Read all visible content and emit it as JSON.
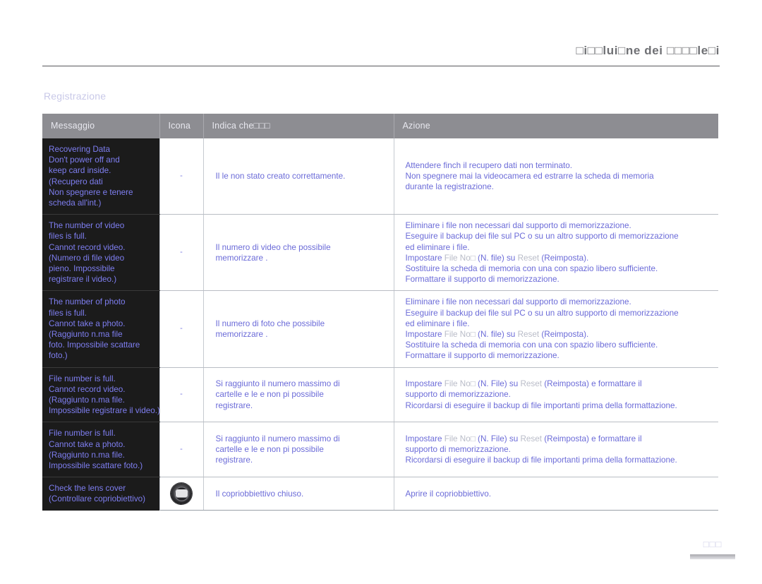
{
  "header": {
    "title": "□i□□lui□ne dei □□□□le□i"
  },
  "section": {
    "title": "Registrazione"
  },
  "table": {
    "columns": [
      "Messaggio",
      "Icona",
      "Indica che□□□",
      "Azione"
    ],
    "rows": [
      {
        "message": [
          "Recovering Data",
          "Don't power off and",
          "keep card inside.",
          "(Recupero dati",
          "Non spegnere e tenere",
          "scheda all'int.)"
        ],
        "icon": "dash-icon",
        "icon_label": "-",
        "description": [
          "Il  le non  stato creato correttamente."
        ],
        "action": [
          "Attendere finch il recupero dati non  terminato.",
          "Non spegnere mai la videocamera ed estrarre la scheda di memoria",
          "durante la registrazione."
        ]
      },
      {
        "message": [
          "The number of video",
          "files is full.",
          "Cannot record video.",
          "(Numero di file video",
          "pieno. Impossibile",
          "registrare il video.)"
        ],
        "icon": "dash-icon",
        "icon_label": "-",
        "description": [
          "Il numero di video che  possibile",
          "memorizzare       ."
        ],
        "action": [
          "Eliminare i file non necessari dal supporto di memorizzazione.",
          "Eseguire il backup dei file sul PC o su un altro supporto di memorizzazione",
          "ed eliminare i file.",
          "Sostituire la scheda di memoria con una con spazio libero sufficiente.",
          "Formattare il supporto di memorizzazione."
        ],
        "action_menu_line": {
          "prefix": "Impostare ",
          "term1": "File No□",
          "mid": " (N. file) su ",
          "term2": "Reset",
          "suffix": " (Reimposta).",
          "index": 3
        }
      },
      {
        "message": [
          "The number of photo",
          "files is full.",
          "Cannot take a photo.",
          "(Raggiunto n.ma  file",
          "foto. Impossibile scattare",
          "foto.)"
        ],
        "icon": "dash-icon",
        "icon_label": "-",
        "description": [
          "Il numero di foto che  possibile",
          "memorizzare       ."
        ],
        "action": [
          "Eliminare i file non necessari dal supporto di memorizzazione.",
          "Eseguire il backup dei file sul PC o su un altro supporto di memorizzazione",
          "ed eliminare i file.",
          "Sostituire la scheda di memoria con una con spazio libero sufficiente.",
          "Formattare il supporto di memorizzazione."
        ],
        "action_menu_line": {
          "prefix": "Impostare ",
          "term1": "File No□",
          "mid": " (N. file) su ",
          "term2": "Reset",
          "suffix": " (Reimposta).",
          "index": 3
        }
      },
      {
        "message": [
          "File number is full.",
          "Cannot record video.",
          "(Raggiunto n.ma  file.",
          "Impossibile registrare il video.)"
        ],
        "icon": "dash-icon",
        "icon_label": "-",
        "description": [
          "Si  raggiunto il numero massimo di",
          "cartelle e  le e non  pi possibile",
          "registrare."
        ],
        "action": [
          "supporto di memorizzazione.",
          "Ricordarsi di eseguire il backup di file importanti prima della formattazione."
        ],
        "action_menu_line": {
          "prefix": "Impostare ",
          "term1": "File No□",
          "mid": " (N. File) su ",
          "term2": "Reset",
          "suffix": " (Reimposta) e formattare il",
          "index": 0
        }
      },
      {
        "message": [
          "File number is full.",
          "Cannot take a photo.",
          "(Raggiunto n.ma  file.",
          "Impossibile scattare foto.)"
        ],
        "icon": "dash-icon",
        "icon_label": "-",
        "description": [
          "Si  raggiunto il numero massimo di",
          "cartelle e  le e non  pi possibile",
          "registrare."
        ],
        "action": [
          "supporto di memorizzazione.",
          "Ricordarsi di eseguire il backup di file importanti prima della formattazione."
        ],
        "action_menu_line": {
          "prefix": "Impostare ",
          "term1": "File No□",
          "mid": " (N. File) su ",
          "term2": "Reset",
          "suffix": " (Reimposta) e formattare il",
          "index": 0
        }
      },
      {
        "message": [
          "Check the lens cover",
          "(Controllare copriobiettivo)"
        ],
        "icon": "lens-cover-icon",
        "icon_label": "",
        "description": [
          "Il copriobbiettivo  chiuso."
        ],
        "action": [
          "Aprire il copriobbiettivo."
        ]
      }
    ]
  },
  "footer": {
    "page_number": "□□□"
  },
  "colors": {
    "text_blue": "#6b6bd8",
    "message_bg": "#1b1b1b",
    "header_bg": "#8d8d92",
    "section_title": "#c9c9e8"
  }
}
